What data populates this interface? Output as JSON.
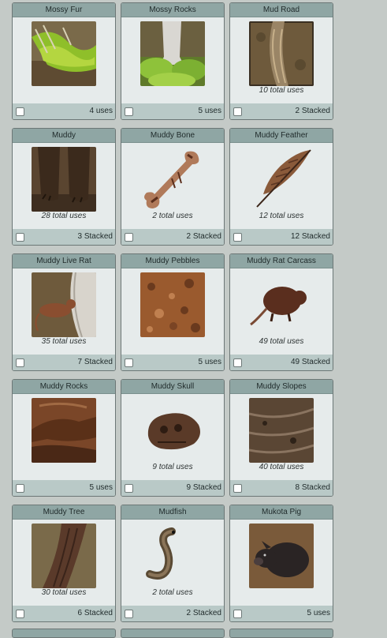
{
  "items": [
    {
      "name": "Mossy Fur",
      "caption": "",
      "count": "4 uses",
      "icon": "mossy-fur-icon"
    },
    {
      "name": "Mossy Rocks",
      "caption": "",
      "count": "5 uses",
      "icon": "mossy-rocks-icon"
    },
    {
      "name": "Mud Road",
      "caption": "10 total uses",
      "count": "2 Stacked",
      "icon": "mud-road-icon"
    },
    {
      "name": "Muddy",
      "caption": "28 total uses",
      "count": "3 Stacked",
      "icon": "muddy-paws-icon"
    },
    {
      "name": "Muddy Bone",
      "caption": "2 total uses",
      "count": "2 Stacked",
      "icon": "muddy-bone-icon"
    },
    {
      "name": "Muddy Feather",
      "caption": "12 total uses",
      "count": "12 Stacked",
      "icon": "muddy-feather-icon"
    },
    {
      "name": "Muddy Live Rat",
      "caption": "35 total uses",
      "count": "7 Stacked",
      "icon": "muddy-live-rat-icon"
    },
    {
      "name": "Muddy Pebbles",
      "caption": "",
      "count": "5 uses",
      "icon": "muddy-pebbles-icon"
    },
    {
      "name": "Muddy Rat Carcass",
      "caption": "49 total uses",
      "count": "49 Stacked",
      "icon": "muddy-rat-carcass-icon"
    },
    {
      "name": "Muddy Rocks",
      "caption": "",
      "count": "5 uses",
      "icon": "muddy-rocks-icon"
    },
    {
      "name": "Muddy Skull",
      "caption": "9 total uses",
      "count": "9 Stacked",
      "icon": "muddy-skull-icon"
    },
    {
      "name": "Muddy Slopes",
      "caption": "40 total uses",
      "count": "8 Stacked",
      "icon": "muddy-slopes-icon"
    },
    {
      "name": "Muddy Tree",
      "caption": "30 total uses",
      "count": "6 Stacked",
      "icon": "muddy-tree-icon"
    },
    {
      "name": "Mudfish",
      "caption": "2 total uses",
      "count": "2 Stacked",
      "icon": "mudfish-icon"
    },
    {
      "name": "Mukota Pig",
      "caption": "",
      "count": "5 uses",
      "icon": "mukota-pig-icon"
    }
  ]
}
